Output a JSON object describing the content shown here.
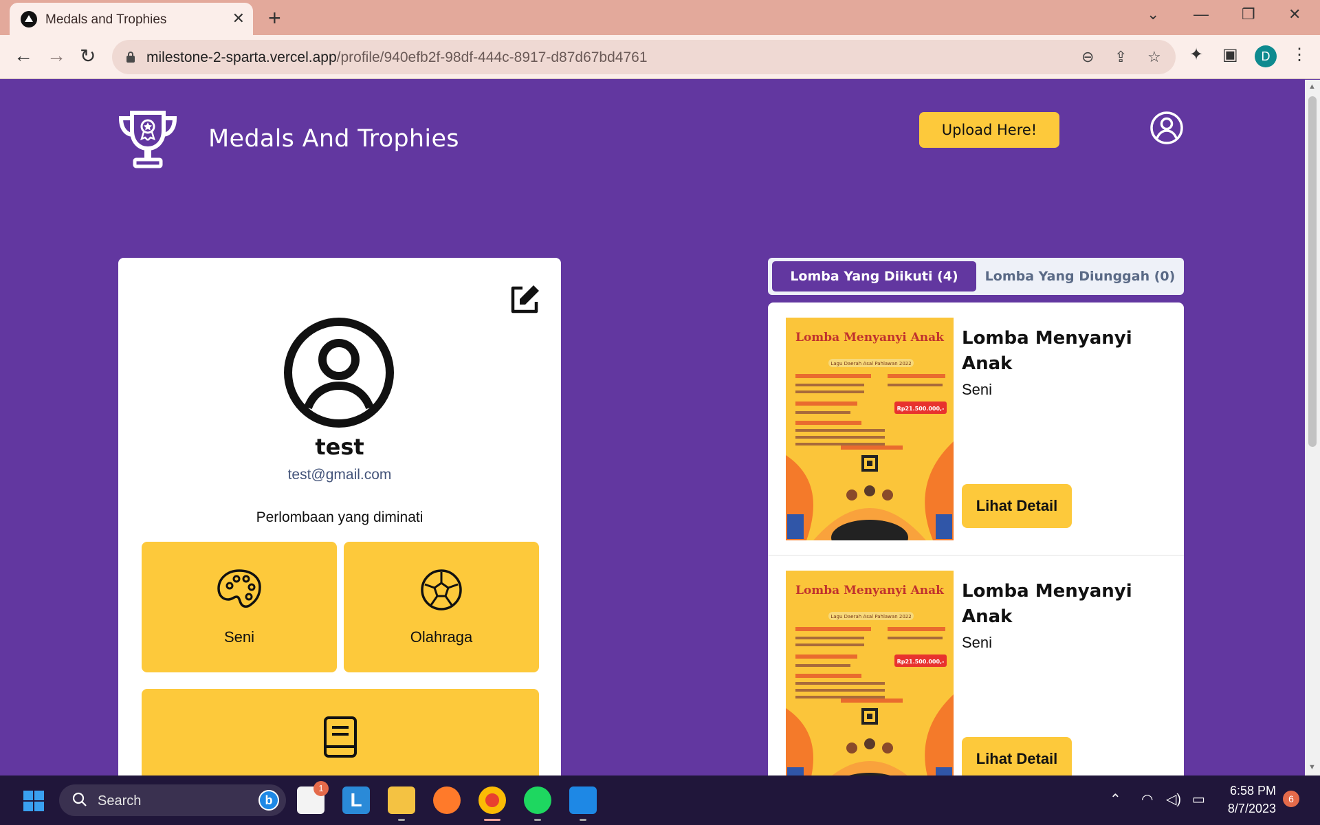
{
  "browser": {
    "tab_title": "Medals and Trophies",
    "url_host": "milestone-2-sparta.vercel.app",
    "url_path": "/profile/940efb2f-98df-444c-8917-d87d67bd4761",
    "profile_initial": "D"
  },
  "header": {
    "site_title": "Medals And Trophies",
    "upload_label": "Upload Here!"
  },
  "profile": {
    "username": "test",
    "email": "test@gmail.com",
    "interests_title": "Perlombaan yang diminati",
    "interests": [
      {
        "label": "Seni",
        "icon": "palette-icon"
      },
      {
        "label": "Olahraga",
        "icon": "soccer-ball-icon"
      },
      {
        "label": "",
        "icon": "book-icon"
      }
    ]
  },
  "tabs": {
    "active": "Lomba Yang Diikuti (4)",
    "inactive": "Lomba Yang Diunggah (0)"
  },
  "contests": [
    {
      "title": "Lomba Menyanyi Anak",
      "category": "Seni",
      "button": "Lihat Detail",
      "poster": {
        "title": "Lomba Menyanyi Anak",
        "subtitle": "Lagu Daerah Asal Pahlawan 2022",
        "prize": "Rp21.500.000,-"
      }
    },
    {
      "title": "Lomba Menyanyi Anak",
      "category": "Seni",
      "button": "Lihat Detail",
      "poster": {
        "title": "Lomba Menyanyi Anak",
        "subtitle": "Lagu Daerah Asal Pahlawan 2022",
        "prize": "Rp21.500.000,-"
      }
    }
  ],
  "taskbar": {
    "search_label": "Search",
    "store_badge": "1",
    "time": "6:58 PM",
    "date": "8/7/2023",
    "notifications": "6"
  },
  "colors": {
    "brand_purple": "#6237a0",
    "accent_yellow": "#fdc93b"
  }
}
